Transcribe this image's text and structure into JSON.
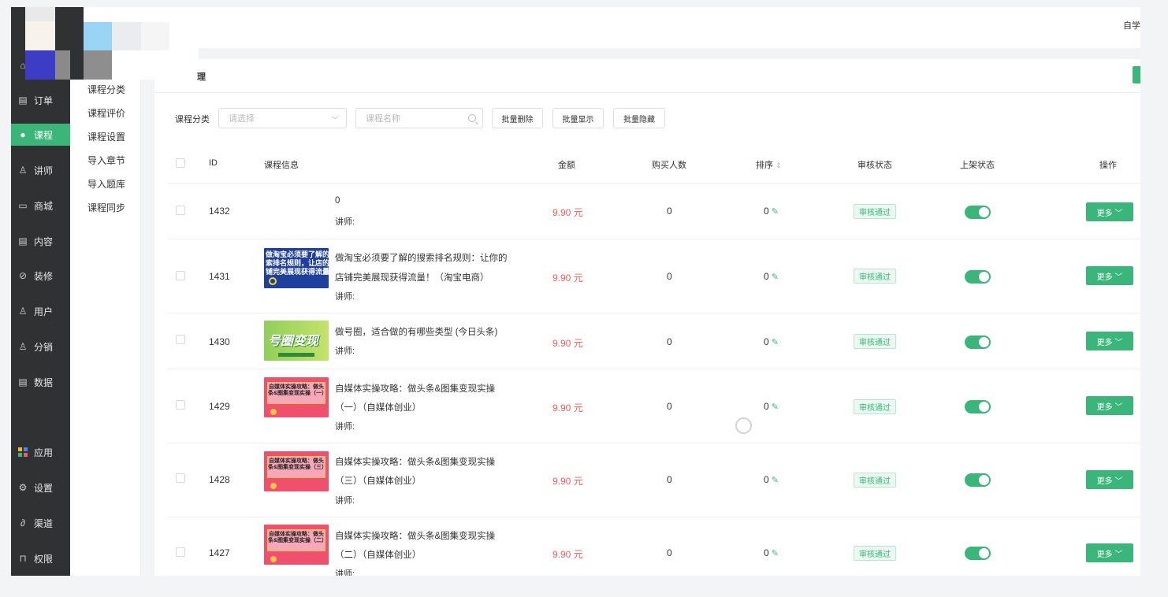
{
  "header": {
    "top_right_text": "自学",
    "breadcrumb_char": "理"
  },
  "sidebar": {
    "items": [
      {
        "label": "订单",
        "icon": "list-icon"
      },
      {
        "label": "课程",
        "icon": "chat-icon",
        "active": true
      },
      {
        "label": "讲师",
        "icon": "user-icon"
      },
      {
        "label": "商城",
        "icon": "shop-icon"
      },
      {
        "label": "内容",
        "icon": "doc-icon"
      },
      {
        "label": "装修",
        "icon": "brush-icon"
      },
      {
        "label": "用户",
        "icon": "person-icon"
      },
      {
        "label": "分销",
        "icon": "users-icon"
      },
      {
        "label": "数据",
        "icon": "data-icon"
      },
      {
        "label": "应用",
        "icon": "apps-icon"
      },
      {
        "label": "设置",
        "icon": "gear-icon"
      },
      {
        "label": "渠道",
        "icon": "link-icon"
      },
      {
        "label": "权限",
        "icon": "lock-icon"
      }
    ]
  },
  "submenu": {
    "items": [
      "课程分类",
      "课程评价",
      "课程设置",
      "导入章节",
      "导入题库",
      "课程同步"
    ]
  },
  "filter": {
    "category_label": "课程分类",
    "category_placeholder": "请选择",
    "name_placeholder": "课程名称",
    "batch_delete": "批量删除",
    "batch_show": "批量显示",
    "batch_hide": "批量隐藏"
  },
  "table": {
    "columns": {
      "id": "ID",
      "info": "课程信息",
      "price": "金额",
      "buyers": "购买人数",
      "sort": "排序",
      "audit": "审核状态",
      "shelf": "上架状态",
      "ops": "操作"
    },
    "teacher_label": "讲师:",
    "more_label": "更多",
    "rows": [
      {
        "id": "1432",
        "title1": "0",
        "title2": "",
        "price": "9.90 元",
        "buyers": "0",
        "sort": "0",
        "audit": "审核通过",
        "on_shelf": true
      },
      {
        "id": "1431",
        "title1": "做淘宝必须要了解的搜索排名规则：让你的",
        "title2": "店铺完美展现获得流量！（淘宝电商）",
        "price": "9.90 元",
        "buyers": "0",
        "sort": "0",
        "audit": "审核通过",
        "on_shelf": true
      },
      {
        "id": "1430",
        "title1": "做号圈，适合做的有哪些类型 (今日头条)",
        "title2": "",
        "price": "9.90 元",
        "buyers": "0",
        "sort": "0",
        "audit": "审核通过",
        "on_shelf": true
      },
      {
        "id": "1429",
        "title1": "自媒体实操攻略：做头条&图集变现实操",
        "title2": "（一）（自媒体创业）",
        "price": "9.90 元",
        "buyers": "0",
        "sort": "0",
        "audit": "审核通过",
        "on_shelf": true
      },
      {
        "id": "1428",
        "title1": "自媒体实操攻略：做头条&图集变现实操",
        "title2": "（三）（自媒体创业）",
        "price": "9.90 元",
        "buyers": "0",
        "sort": "0",
        "audit": "审核通过",
        "on_shelf": true
      },
      {
        "id": "1427",
        "title1": "自媒体实操攻略：做头条&图集变现实操",
        "title2": "（二）（自媒体创业）",
        "price": "9.90 元",
        "buyers": "0",
        "sort": "0",
        "audit": "审核通过",
        "on_shelf": true
      }
    ]
  },
  "thumbs": {
    "t1431": {
      "lines": [
        "做淘宝必须要了解的",
        "索排名规则，让店的",
        "铺完美展现获得流量"
      ]
    },
    "t1430": {
      "text": "号圈变现"
    },
    "t1429": {
      "text": "自媒体实操攻略：做头条&图集变现实操（一）"
    },
    "t1428": {
      "text": "自媒体实操攻略：做头条&图集变现实操（三）"
    },
    "t1427": {
      "text": "自媒体实操攻略：做头条&图集变现实操（二）"
    }
  },
  "colors": {
    "accent": "#3bb67a",
    "price": "#f25c5c",
    "sidebar": "#2f3133"
  }
}
